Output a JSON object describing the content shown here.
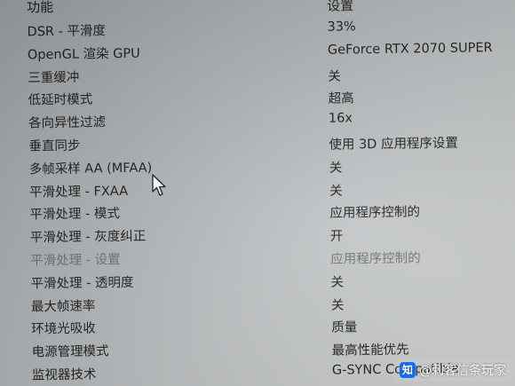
{
  "header": {
    "feature_label": "功能",
    "setting_label": "设置"
  },
  "settings": [
    {
      "feature": "DSR - 平滑度",
      "value": "33%"
    },
    {
      "feature": "OpenGL 渲染 GPU",
      "value": "GeForce RTX 2070 SUPER"
    },
    {
      "feature": "三重缓冲",
      "value": "关"
    },
    {
      "feature": "低延时模式",
      "value": "超高"
    },
    {
      "feature": "各向异性过滤",
      "value": "16x"
    },
    {
      "feature": "垂直同步",
      "value": "使用 3D 应用程序设置"
    },
    {
      "feature": "多帧采样 AA (MFAA)",
      "value": "关"
    },
    {
      "feature": "平滑处理 - FXAA",
      "value": "关"
    },
    {
      "feature": "平滑处理 - 模式",
      "value": "应用程序控制的"
    },
    {
      "feature": "平滑处理 - 灰度纠正",
      "value": "开"
    },
    {
      "feature": "平滑处理 - 设置",
      "value": "应用程序控制的"
    },
    {
      "feature": "平滑处理 - 透明度",
      "value": "关"
    },
    {
      "feature": "最大帧速率",
      "value": "关"
    },
    {
      "feature": "环境光吸收",
      "value": "质量"
    },
    {
      "feature": "电源管理模式",
      "value": "最高性能优先"
    },
    {
      "feature": "监视器技术",
      "value": "G-SYNC Compatible"
    }
  ],
  "watermark": {
    "logo_text": "知",
    "text": "@刺客信条玩家"
  },
  "colors": {
    "text": "#202020",
    "dimmed_text": "#707274",
    "background": "#c0c3c5"
  }
}
